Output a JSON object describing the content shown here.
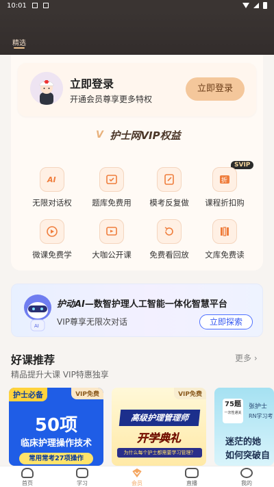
{
  "status_bar": {
    "time": "10:01"
  },
  "header": {
    "active_tab": "精选"
  },
  "login_card": {
    "title": "立即登录",
    "subtitle": "开通会员尊享更多特权",
    "button": "立即登录"
  },
  "vip_section": {
    "title": "护士网VIP权益",
    "svip_badge": "SVIP",
    "benefits": [
      {
        "label": "无限对话权",
        "icon": "ai-chat-icon"
      },
      {
        "label": "题库免费用",
        "icon": "question-bank-icon"
      },
      {
        "label": "模考反复做",
        "icon": "mock-exam-icon"
      },
      {
        "label": "课程折扣购",
        "icon": "discount-icon"
      },
      {
        "label": "微课免费学",
        "icon": "micro-course-icon"
      },
      {
        "label": "大咖公开课",
        "icon": "open-class-icon"
      },
      {
        "label": "免费看回放",
        "icon": "replay-icon"
      },
      {
        "label": "文库免费读",
        "icon": "library-icon"
      }
    ]
  },
  "ai_banner": {
    "brand": "护动AI",
    "title_rest": "—数智护理人工智能一体化智慧平台",
    "subtitle": "VIP尊享无限次对话",
    "button": "立即探索"
  },
  "recommend": {
    "title": "好课推荐",
    "more": "更多",
    "subtitle": "精品提升大课 VIP特惠独享"
  },
  "courses": [
    {
      "tag": "护士必备",
      "vip": "VIP免费",
      "big": "50项",
      "mid": "临床护理操作技术",
      "pill": "常用常考27项操作"
    },
    {
      "vip": "VIP免费",
      "banner": "高级护理管理师",
      "big": "开学典礼",
      "question": "为什么每个护士都需要学习管理？"
    },
    {
      "badge_num": "75题",
      "badge_sub": "一次性通关",
      "name": "张护士",
      "sub": "RN学习考",
      "line1": "迷茫的她",
      "line2": "如何突破自"
    }
  ],
  "tabbar": [
    {
      "label": "首页",
      "icon": "home-icon"
    },
    {
      "label": "学习",
      "icon": "study-icon"
    },
    {
      "label": "会员",
      "icon": "vip-icon",
      "active": true
    },
    {
      "label": "直播",
      "icon": "live-icon"
    },
    {
      "label": "我的",
      "icon": "profile-icon"
    }
  ]
}
